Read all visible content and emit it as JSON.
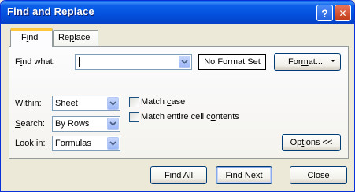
{
  "window": {
    "title": "Find and Replace",
    "help_glyph": "?",
    "close_glyph": "✕"
  },
  "tabs": [
    {
      "label_pre": "F",
      "label_u": "i",
      "label_post": "nd",
      "active": true
    },
    {
      "label_pre": "Re",
      "label_u": "p",
      "label_post": "lace",
      "active": false
    }
  ],
  "find_what": {
    "label_pre": "F",
    "label_u": "i",
    "label_post": "nd what:",
    "value": ""
  },
  "format_status": "No Format Set",
  "format_button": {
    "label_pre": "For",
    "label_u": "m",
    "label_post": "at..."
  },
  "within": {
    "label_pre": "Wit",
    "label_u": "h",
    "label_post": "in:",
    "value": "Sheet"
  },
  "search": {
    "label_pre": "",
    "label_u": "S",
    "label_post": "earch:",
    "value": "By Rows"
  },
  "look_in": {
    "label_pre": "",
    "label_u": "L",
    "label_post": "ook in:",
    "value": "Formulas"
  },
  "match_case": {
    "label_pre": "Match ",
    "label_u": "c",
    "label_post": "ase",
    "checked": false
  },
  "match_entire": {
    "label_pre": "Match entire cell c",
    "label_u": "o",
    "label_post": "ntents",
    "checked": false
  },
  "options_button": {
    "label_pre": "Op",
    "label_u": "t",
    "label_post": "ions <<"
  },
  "footer": {
    "find_all": {
      "label_pre": "F",
      "label_u": "i",
      "label_post": "nd All"
    },
    "find_next": {
      "label_pre": "",
      "label_u": "F",
      "label_post": "ind Next"
    },
    "close": {
      "label": "Close"
    }
  },
  "colors": {
    "titlebar": "#0351de",
    "dialog_bg": "#ece9d8",
    "active_tab_accent": "#ffc83c",
    "close_button": "#c13a17"
  },
  "icons": {
    "help": "help-icon",
    "close": "close-icon",
    "dropdown": "chevron-down-icon",
    "menu_arrow": "triangle-down-icon"
  }
}
